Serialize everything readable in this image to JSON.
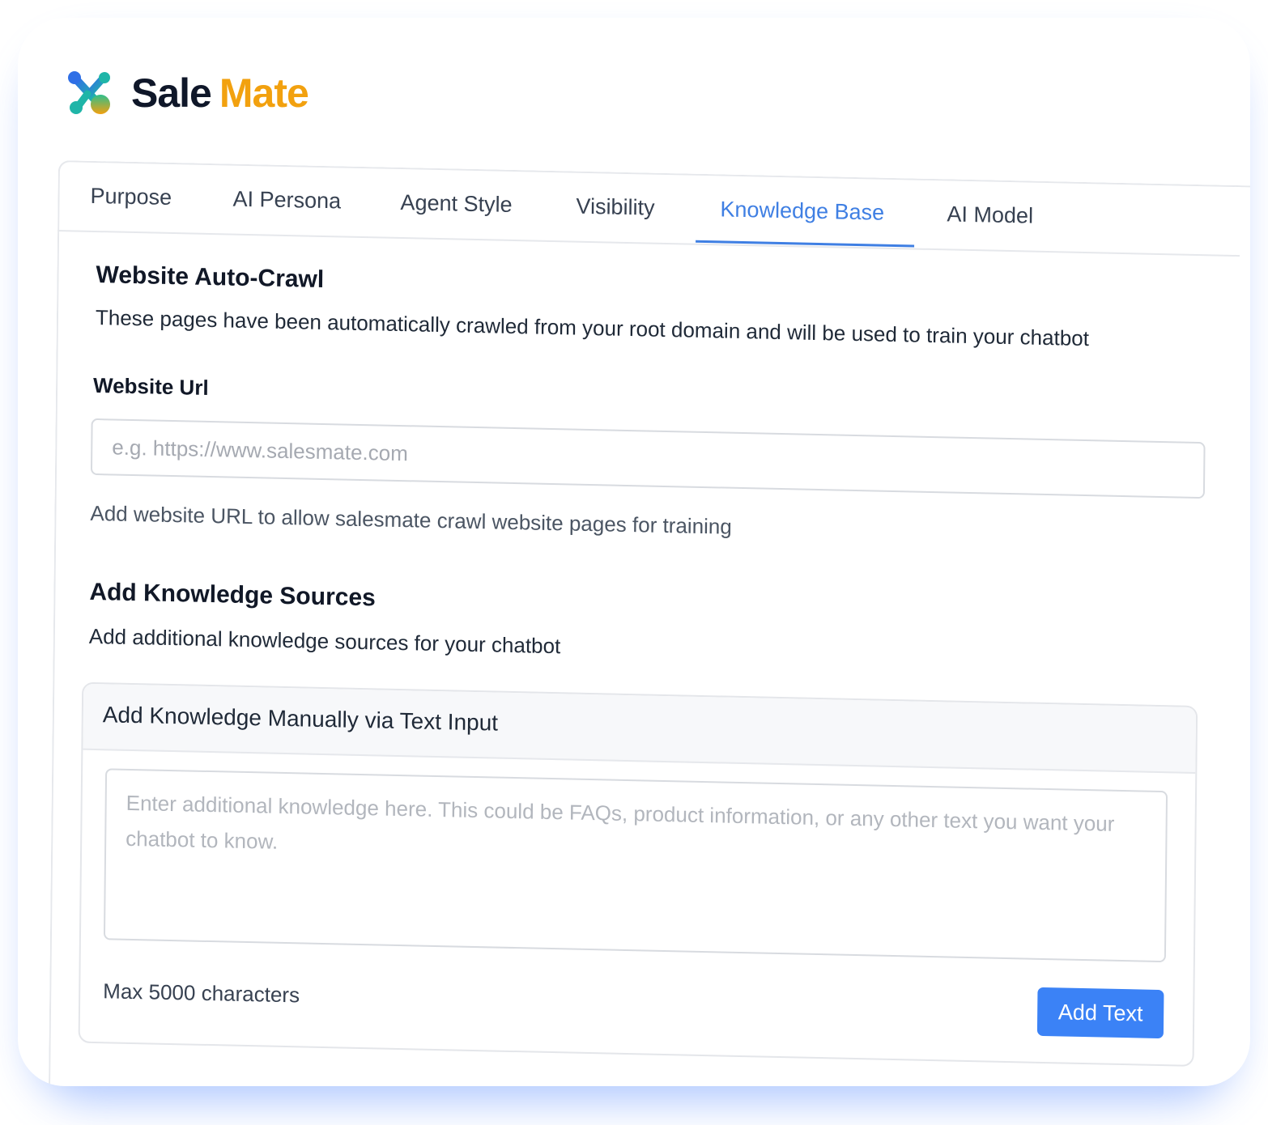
{
  "brand": {
    "name_part1": "Sale",
    "name_part2": "Mate",
    "icon": "salemate-logo-icon",
    "colors": {
      "primary": "#0f1729",
      "accent": "#f2a10f"
    }
  },
  "tabs": [
    {
      "label": "Purpose",
      "active": false
    },
    {
      "label": "AI Persona",
      "active": false
    },
    {
      "label": "Agent Style",
      "active": false
    },
    {
      "label": "Visibility",
      "active": false
    },
    {
      "label": "Knowledge Base",
      "active": true
    },
    {
      "label": "AI Model",
      "active": false
    }
  ],
  "crawl": {
    "title": "Website Auto-Crawl",
    "description": "These pages have been automatically crawled from your root domain and will be used to train your chatbot",
    "url_label": "Website Url",
    "url_placeholder": "e.g. https://www.salesmate.com",
    "url_value": "",
    "helper": "Add website URL to allow salesmate crawl website pages for training"
  },
  "sources": {
    "title": "Add Knowledge Sources",
    "description": "Add additional knowledge sources for your chatbot",
    "manual": {
      "title": "Add Knowledge Manually via Text Input",
      "placeholder": "Enter additional knowledge here. This could be FAQs, product information, or any other text you want your chatbot to know.",
      "value": "",
      "max_note": "Max 5000 characters",
      "button_label": "Add Text"
    }
  },
  "colors": {
    "accent": "#3f7fe3",
    "button": "#3b82f6",
    "glow": "#6f9bff"
  }
}
